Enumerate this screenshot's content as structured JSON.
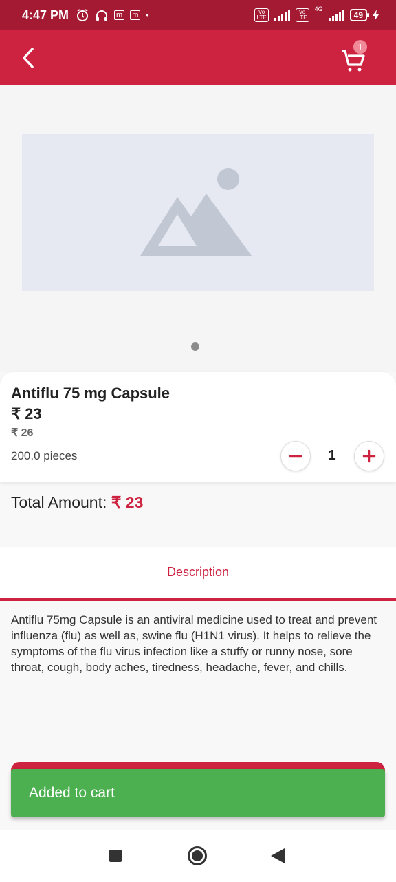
{
  "status_bar": {
    "time": "4:47 PM",
    "battery": "49",
    "network": "4G"
  },
  "header": {
    "cart_count": "1"
  },
  "product": {
    "name": "Antiflu 75 mg Capsule",
    "price": "₹ 23",
    "mrp": "₹ 26",
    "quantity_text": "200.0 pieces",
    "quantity": "1"
  },
  "total": {
    "label": "Total Amount: ",
    "amount": "₹ 23"
  },
  "tabs": {
    "description": "Description"
  },
  "description": "Antiflu 75mg Capsule is an antiviral medicine used to treat and prevent influenza (flu) as well as, swine flu (H1N1 virus). It helps to relieve the symptoms of the flu virus infection like a stuffy or runny nose, sore throat, cough, body aches, tiredness, headache, fever, and chills.",
  "snackbar": {
    "message": "Added to cart"
  },
  "colors": {
    "primary": "#cd2240",
    "status_bar": "#a31a32",
    "snackbar": "#4caf50"
  }
}
